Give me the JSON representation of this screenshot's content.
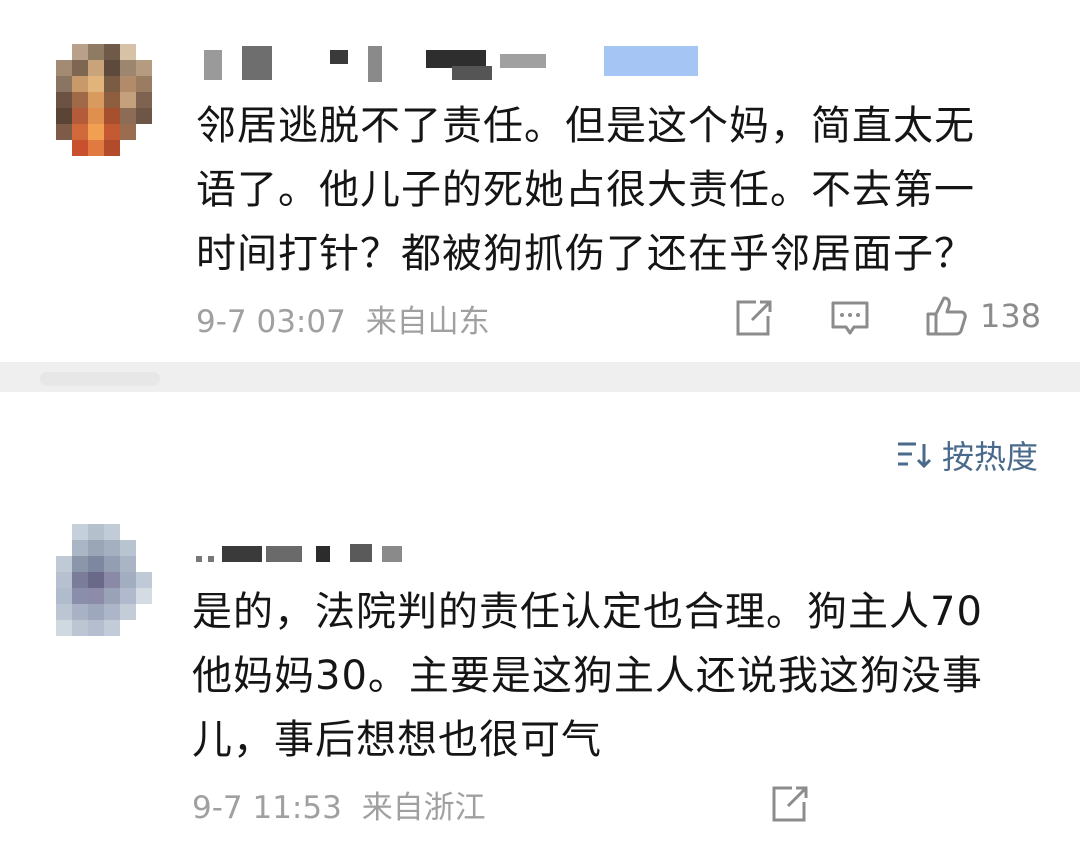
{
  "comments": [
    {
      "text_lines": [
        "邻居逃脱不了责任。但是这个妈，简直太无",
        "语了。他儿子的死她占很大责任。不去第一",
        "时间打针？都被狗抓伤了还在乎邻居面子？"
      ],
      "timestamp": "9-7 03:07",
      "location": "来自山东",
      "like_count": "138",
      "icons": [
        "share-icon",
        "comment-icon",
        "like-icon"
      ]
    },
    {
      "text_lines": [
        "是的，法院判的责任认定也合理。狗主人70",
        "他妈妈30。主要是这狗主人还说我这狗没事",
        "儿，事后想想也很可气"
      ],
      "timestamp": "9-7 11:53",
      "location": "来自浙江",
      "icons": [
        "share-icon"
      ]
    }
  ],
  "sort": {
    "label": "按热度",
    "icon": "sort-icon"
  },
  "colors": {
    "meta_text": "#a0a0a0",
    "sort_accent": "#4a6a8c",
    "divider": "#efefef"
  }
}
